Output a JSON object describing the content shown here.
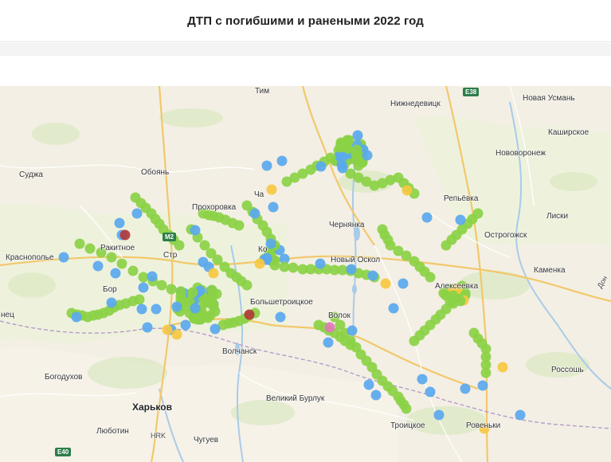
{
  "header": {
    "title": "ДТП с погибшими и ранеными 2022 год"
  },
  "colors": {
    "injured": "#8bd145",
    "minor": "#5aa8ee",
    "severe": "#f7c841",
    "fatal": "#b23a3a",
    "other": "#e079b8"
  },
  "map": {
    "cities": [
      {
        "id": "tim",
        "name": "Тим"
      },
      {
        "id": "nizhnedevitsk",
        "name": "Нижнедевицк"
      },
      {
        "id": "novaya-usman",
        "name": "Новая Усмань"
      },
      {
        "id": "kashirskoe",
        "name": "Каширское"
      },
      {
        "id": "novovoronezh",
        "name": "Нововоронеж"
      },
      {
        "id": "sudzha",
        "name": "Суджа"
      },
      {
        "id": "oboyan",
        "name": "Обоянь"
      },
      {
        "id": "repyovka",
        "name": "Репьёвка"
      },
      {
        "id": "prokhorovka",
        "name": "Прохоровка"
      },
      {
        "id": "liski",
        "name": "Лиски"
      },
      {
        "id": "chernyanka",
        "name": "Чернянка"
      },
      {
        "id": "ostrogozhsk",
        "name": "Острогожск"
      },
      {
        "id": "rakitnoe",
        "name": "Ракитное"
      },
      {
        "id": "krasnopolye",
        "name": "Краснополье"
      },
      {
        "id": "stroitel",
        "name": "Стр"
      },
      {
        "id": "novy-oskol",
        "name": "Новый Оскол"
      },
      {
        "id": "kamenka",
        "name": "Каменка"
      },
      {
        "id": "borisovka",
        "name": "Бор"
      },
      {
        "id": "alekseevka",
        "name": "Алексеевка"
      },
      {
        "id": "bolshetroitskoe",
        "name": "Большетроицкое"
      },
      {
        "id": "volokonovka",
        "name": "Волок"
      },
      {
        "id": "nec",
        "name": "нец"
      },
      {
        "id": "volchansk",
        "name": "Волчанск"
      },
      {
        "id": "rossosh",
        "name": "Россошь"
      },
      {
        "id": "bogodukhov",
        "name": "Богодухов"
      },
      {
        "id": "velikiy-burluk",
        "name": "Великий Бурлук"
      },
      {
        "id": "kharkov",
        "name": "Харьков"
      },
      {
        "id": "troitskoe",
        "name": "Троицкое"
      },
      {
        "id": "rovenki",
        "name": "Ровеньки"
      },
      {
        "id": "lyubotin",
        "name": "Люботин"
      },
      {
        "id": "chuguev",
        "name": "Чугуев"
      },
      {
        "id": "hrk",
        "name": "HRK"
      },
      {
        "id": "cha",
        "name": "Ча"
      },
      {
        "id": "ko",
        "name": "Ко"
      },
      {
        "id": "don",
        "name": "Дон"
      }
    ],
    "shields": [
      {
        "id": "e38",
        "label": "E38"
      },
      {
        "id": "e40",
        "label": "E40"
      },
      {
        "id": "m2",
        "label": "M2"
      }
    ]
  }
}
